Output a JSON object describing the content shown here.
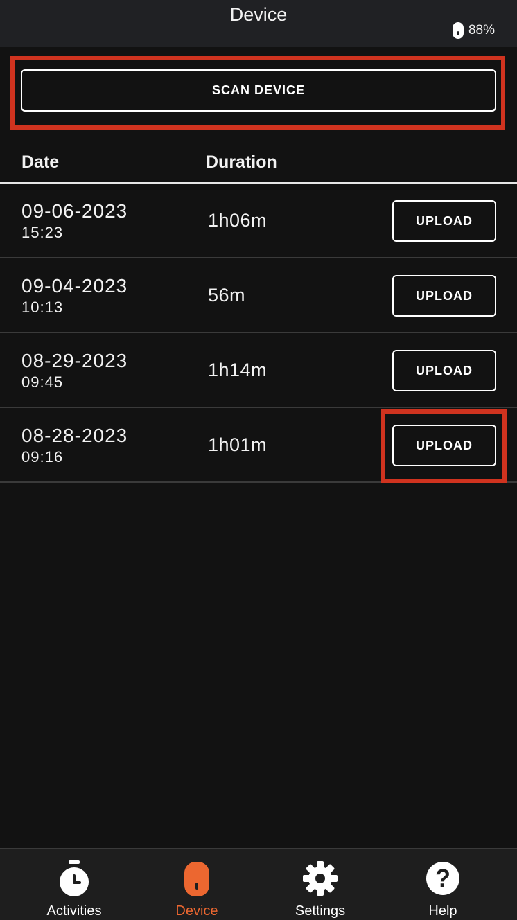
{
  "header": {
    "title": "Device",
    "battery_percent": "88%"
  },
  "scan_button_label": "SCAN DEVICE",
  "table": {
    "columns": [
      "Date",
      "Duration"
    ],
    "rows": [
      {
        "date": "09-06-2023",
        "time": "15:23",
        "duration": "1h06m",
        "action": "UPLOAD"
      },
      {
        "date": "09-04-2023",
        "time": "10:13",
        "duration": "56m",
        "action": "UPLOAD"
      },
      {
        "date": "08-29-2023",
        "time": "09:45",
        "duration": "1h14m",
        "action": "UPLOAD"
      },
      {
        "date": "08-28-2023",
        "time": "09:16",
        "duration": "1h01m",
        "action": "UPLOAD"
      }
    ]
  },
  "tabs": [
    {
      "label": "Activities",
      "icon": "stopwatch-icon",
      "active": false
    },
    {
      "label": "Device",
      "icon": "device-icon",
      "active": true
    },
    {
      "label": "Settings",
      "icon": "gear-icon",
      "active": false
    },
    {
      "label": "Help",
      "icon": "help-icon",
      "active": false
    }
  ],
  "colors": {
    "accent": "#ec6730",
    "highlight": "#d0331f",
    "background": "#121212"
  }
}
